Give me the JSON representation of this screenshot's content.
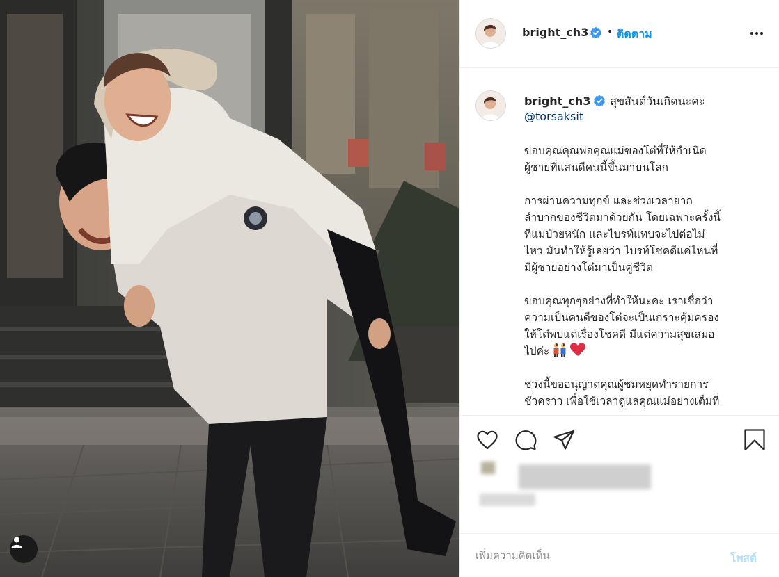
{
  "header": {
    "username": "bright_ch3",
    "separator": "•",
    "follow_label": "ติดตาม"
  },
  "caption": {
    "username": "bright_ch3",
    "first_line": "สุขสันต์วันเกิดนะคะ",
    "mention": "@torsaksit",
    "paragraphs": [
      "ขอบคุณคุณพ่อคุณแม่ของโต๋ที่ให้กำเนิด\nผู้ชายที่แสนดีคนนี้ขึ้นมาบนโลก",
      "การผ่านความทุกข์ และช่วงเวลายาก\nลำบากของชีวิตมาด้วยกัน โดยเฉพาะครั้งนี้\nที่แม่ป่วยหนัก และไบรท์แทบจะไปต่อไม่\nไหว มันทำให้รู้เลยว่า ไบรท์โชคดีแค่ไหนที่\nมีผู้ชายอย่างโต๋มาเป็นคู่ชีวิต",
      "ขอบคุณทุกๆอย่างที่ทำให้นะคะ เราเชื่อว่า\nความเป็นคนดีของโต๋จะเป็นเกราะคุ้มครอง\nให้โต๋พบแต่เรื่องโชคดี มีแต่ความสุขเสมอ\nไปค่ะ",
      "ช่วงนี้ขออนุญาตคุณผู้ชมหยุดทำรายการ\nชั่วคราว เพื่อใช้เวลาดูแลคุณแม่อย่างเต็มที่"
    ]
  },
  "comment_box": {
    "placeholder": "เพิ่มความคิดเห็น",
    "post_label": "โพสต์"
  },
  "colors": {
    "link": "#0095f6",
    "verified": "#3897f0",
    "mention": "#00376b",
    "post_disabled": "#b2dffc"
  },
  "icons": [
    "verified-badge-icon",
    "more-options-icon",
    "heart-icon",
    "comment-icon",
    "share-icon",
    "bookmark-icon",
    "user-tag-icon",
    "couple-emoji",
    "red-heart-emoji"
  ]
}
